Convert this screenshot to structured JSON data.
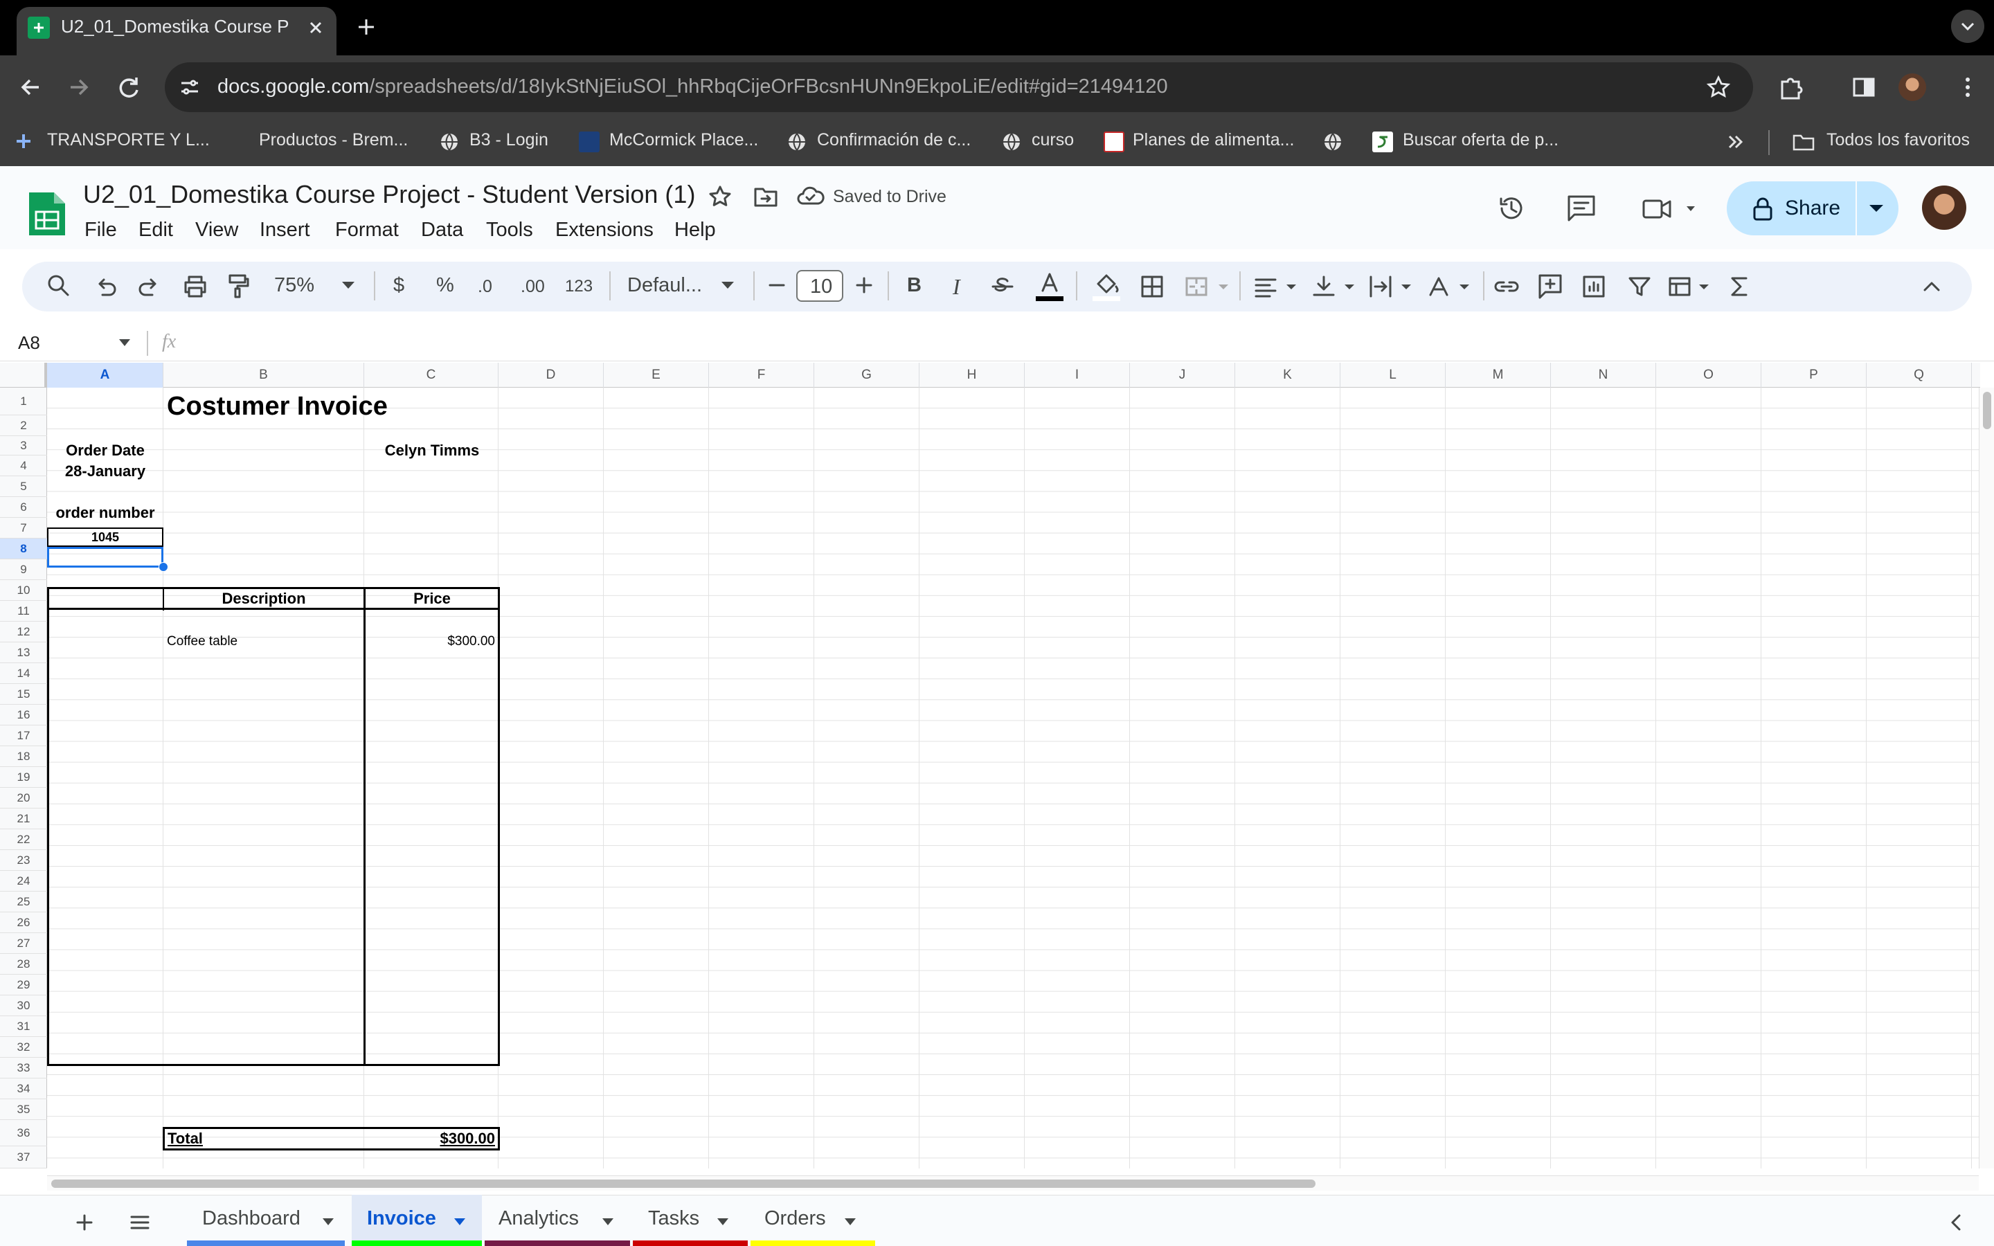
{
  "browser": {
    "tab_title": "U2_01_Domestika Course Pro",
    "url_host": "docs.google.com",
    "url_path": "/spreadsheets/d/18IykStNjEiuSOl_hhRbqCijeOrFBcsnHUNn9EkpoLiE/edit#gid=21494120",
    "bookmarks": [
      "TRANSPORTE Y L...",
      "Productos - Brem...",
      "B3 - Login",
      "McCormick Place...",
      "Confirmación de c...",
      "curso",
      "Planes de alimenta...",
      "Buscar oferta de p..."
    ],
    "all_bookmarks": "Todos los favoritos"
  },
  "doc": {
    "title": "U2_01_Domestika Course Project - Student Version (1)",
    "saved_status": "Saved to Drive",
    "share_label": "Share",
    "menus": [
      "File",
      "Edit",
      "View",
      "Insert",
      "Format",
      "Data",
      "Tools",
      "Extensions",
      "Help"
    ]
  },
  "toolbar": {
    "zoom": "75%",
    "currency": "$",
    "percent": "%",
    "dec_decrease": ".0",
    "dec_increase": ".00",
    "format_num": "123",
    "font": "Defaul...",
    "font_size": "10",
    "bold": "B",
    "italic": "I"
  },
  "formula_bar": {
    "name_box": "A8",
    "fx": "fx",
    "formula": ""
  },
  "columns": [
    "A",
    "B",
    "C",
    "D",
    "E",
    "F",
    "G",
    "H",
    "I",
    "J",
    "K",
    "L",
    "M",
    "N",
    "O",
    "P",
    "Q"
  ],
  "rows": [
    "1",
    "2",
    "3",
    "4",
    "5",
    "6",
    "7",
    "8",
    "9",
    "10",
    "11",
    "12",
    "13",
    "14",
    "15",
    "16",
    "17",
    "18",
    "19",
    "20",
    "21",
    "22",
    "23",
    "24",
    "25",
    "26",
    "27",
    "28",
    "29",
    "30",
    "31",
    "32",
    "33",
    "34",
    "35",
    "36",
    "37"
  ],
  "sheet": {
    "title": "Costumer Invoice",
    "order_date_label": "Order Date",
    "order_date": "28-January",
    "customer": "Celyn Timms",
    "order_number_label": "order number",
    "order_number": "1045",
    "desc_header": "Description",
    "price_header": "Price",
    "item_desc": "Coffee table",
    "item_price": "$300.00",
    "total_label": "Total",
    "total_value": "$300.00"
  },
  "sheet_tabs": [
    {
      "label": "Dashboard",
      "color": "#4a86e8"
    },
    {
      "label": "Invoice",
      "color": "#00ff00",
      "active": true
    },
    {
      "label": "Analytics",
      "color": "#741b47"
    },
    {
      "label": "Tasks",
      "color": "#cc0000"
    },
    {
      "label": "Orders",
      "color": "#ffff00"
    }
  ],
  "colors": {
    "accent": "#0b57d0",
    "share_bg": "#c2e7ff",
    "selection": "#1a73e8"
  }
}
